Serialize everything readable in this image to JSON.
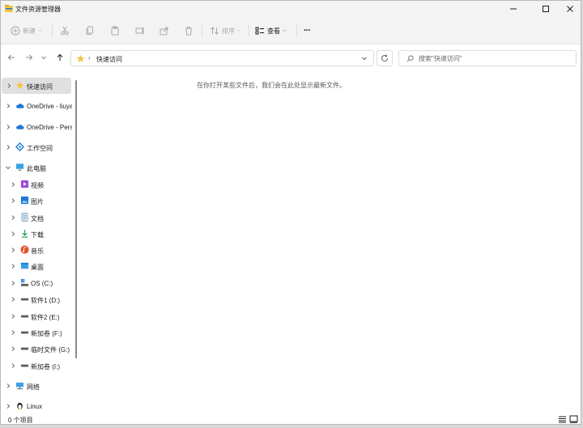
{
  "window": {
    "title": "文件资源管理器"
  },
  "toolbar": {
    "new_label": "新建",
    "sort_label": "排序",
    "view_label": "查看",
    "more_label": "···"
  },
  "address": {
    "chevron": "›",
    "path": "快速访问"
  },
  "search": {
    "placeholder": "搜索\"快速访问\""
  },
  "sidebar": {
    "items": [
      {
        "label": "快速访问",
        "icon": "star-icon"
      },
      {
        "label": "OneDrive - liuya",
        "icon": "onedrive-cloud-icon"
      },
      {
        "label": "OneDrive - Pers",
        "icon": "onedrive-cloud-icon"
      },
      {
        "label": "工作空间",
        "icon": "workspace-icon"
      },
      {
        "label": "此电脑",
        "icon": "this-pc-icon"
      },
      {
        "label": "视频",
        "icon": "videos-icon"
      },
      {
        "label": "图片",
        "icon": "pictures-icon"
      },
      {
        "label": "文档",
        "icon": "documents-icon"
      },
      {
        "label": "下载",
        "icon": "downloads-icon"
      },
      {
        "label": "音乐",
        "icon": "music-icon"
      },
      {
        "label": "桌面",
        "icon": "desktop-icon"
      },
      {
        "label": "OS (C:)",
        "icon": "os-drive-icon"
      },
      {
        "label": "软件1 (D:)",
        "icon": "drive-icon"
      },
      {
        "label": "软件2 (E:)",
        "icon": "drive-icon"
      },
      {
        "label": "新加卷 (F:)",
        "icon": "drive-icon"
      },
      {
        "label": "临时文件 (G:)",
        "icon": "drive-icon"
      },
      {
        "label": "新加卷 (I:)",
        "icon": "drive-icon"
      },
      {
        "label": "网络",
        "icon": "network-icon"
      },
      {
        "label": "Linux",
        "icon": "linux-penguin-icon"
      }
    ]
  },
  "content": {
    "empty_message": "在你打开某些文件后，我们会在此处显示最新文件。"
  },
  "status": {
    "item_count": "0 个项目"
  },
  "colors": {
    "window_bg": "#ffffff",
    "chrome_bg": "#f3f3f3",
    "selected_bg": "#e0e0e0",
    "folder_yellow": "#f4c542",
    "accent_blue": "#1e78d4"
  }
}
